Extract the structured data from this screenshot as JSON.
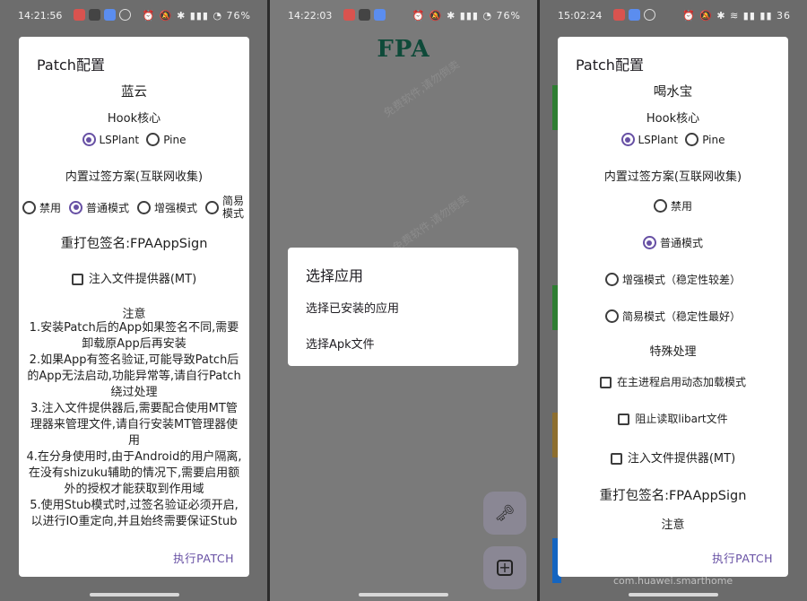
{
  "panel1": {
    "status": {
      "time": "14:21:56",
      "battery": "76%"
    },
    "dialog": {
      "title": "Patch配置",
      "app_name": "蓝云",
      "hook_label": "Hook核心",
      "hook_options": [
        "LSPlant",
        "Pine"
      ],
      "bypass_label": "内置过签方案(互联网收集)",
      "bypass_options": [
        "禁用",
        "普通模式",
        "增强模式",
        "简易模式"
      ],
      "signature": "重打包签名:FPAAppSign",
      "inject_label": "注入文件提供器(MT)",
      "notes_title": "注意",
      "notes": [
        "1.安装Patch后的App如果签名不同,需要卸载原App后再安装",
        "2.如果App有签名验证,可能导致Patch后的App无法启动,功能异常等,请自行Patch绕过处理",
        "3.注入文件提供器后,需要配合使用MT管理器来管理文件,请自行安装MT管理器使用",
        "4.在分身使用时,由于Android的用户隔离,在没有shizuku辅助的情况下,需要启用额外的授权才能获取到作用域",
        "5.使用Stub模式时,过签名验证必须开启,以进行IO重定向,并且始终需要保证Stub"
      ],
      "action": "执行PATCH"
    }
  },
  "panel2": {
    "status": {
      "time": "14:22:03",
      "battery": "76%"
    },
    "app_title": "FPA",
    "dialog": {
      "title": "选择应用",
      "items": [
        "选择已安装的应用",
        "选择Apk文件"
      ]
    }
  },
  "panel3": {
    "status": {
      "time": "15:02:24",
      "battery": "36"
    },
    "dialog": {
      "title": "Patch配置",
      "app_name": "喝水宝",
      "hook_label": "Hook核心",
      "hook_options": [
        "LSPlant",
        "Pine"
      ],
      "bypass_label": "内置过签方案(互联网收集)",
      "bypass_options": [
        "禁用",
        "普通模式",
        "增强模式（稳定性较差）",
        "简易模式（稳定性最好）"
      ],
      "special_label": "特殊处理",
      "special_options": [
        "在主进程启用动态加载模式",
        "阻止读取libart文件",
        "注入文件提供器(MT)"
      ],
      "signature": "重打包签名:FPAAppSign",
      "notes_title": "注意",
      "action": "执行PATCH"
    },
    "background_text": "com.huawei.smarthome"
  },
  "watermark": "免费软件,请勿倒卖"
}
